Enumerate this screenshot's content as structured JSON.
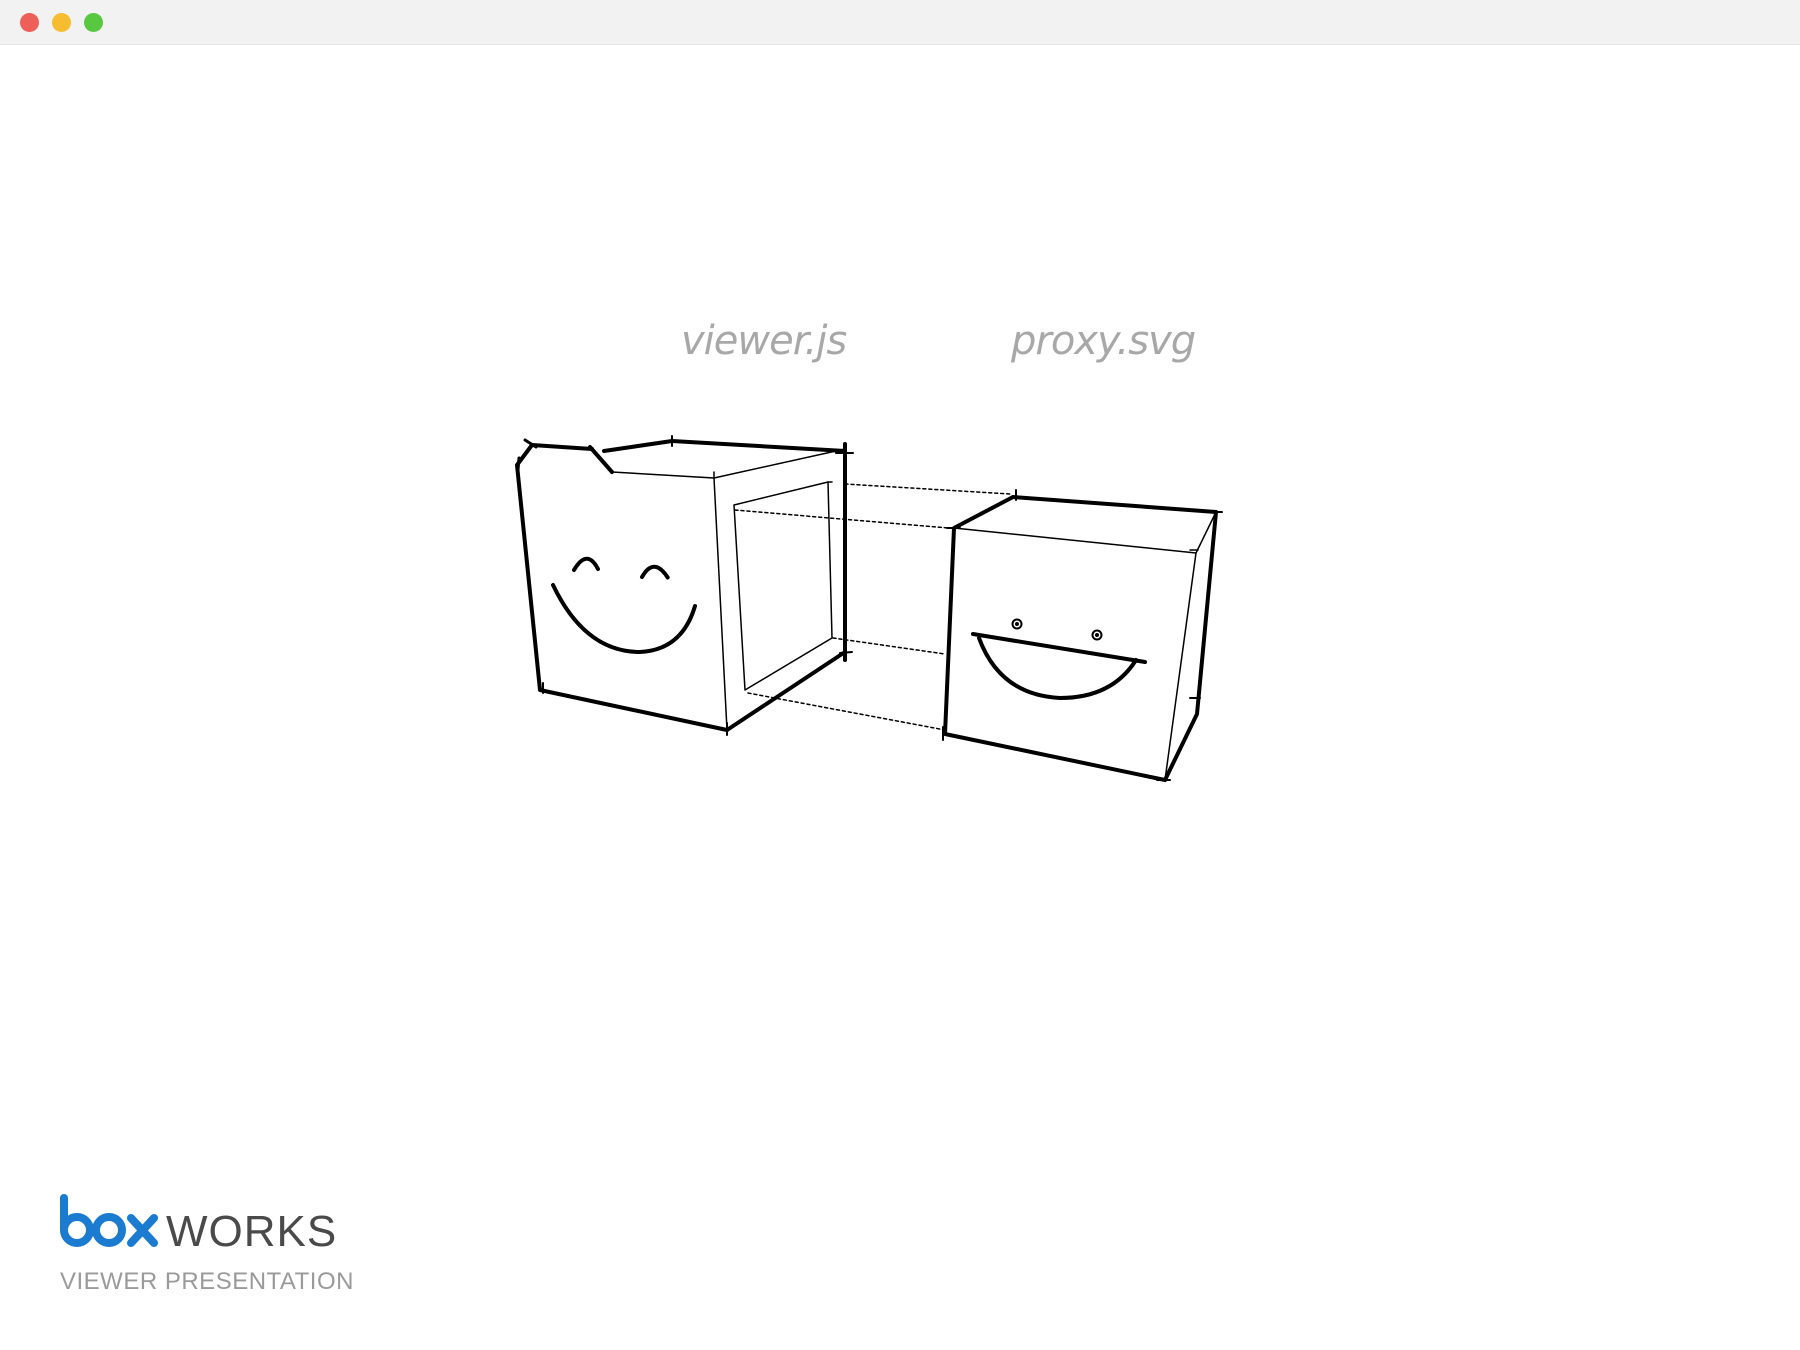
{
  "window": {
    "controls": [
      {
        "name": "close",
        "color": "#ed5f58"
      },
      {
        "name": "minimize",
        "color": "#f5bd2f"
      },
      {
        "name": "zoom",
        "color": "#57c840"
      }
    ]
  },
  "diagram": {
    "left_label": "viewer.js",
    "right_label": "proxy.svg",
    "left_box_icon": "happy-closed-eyes-face",
    "right_box_icon": "grinning-face-icon",
    "stroke_color": "#000000"
  },
  "branding": {
    "logo_text": "box",
    "logo_color": "#1a7bd0",
    "product": "WORKS",
    "subtitle": "VIEWER PRESENTATION"
  }
}
